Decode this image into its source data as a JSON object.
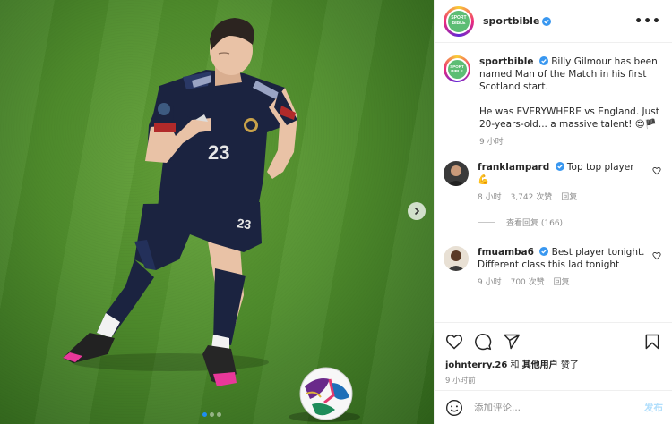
{
  "account": {
    "username": "sportbible",
    "logo_text_top": "SPORT",
    "logo_text_bottom": "BIBLE",
    "brand_color": "#5dbd74",
    "verified_color": "#3897f0"
  },
  "header": {
    "more_label": "•••"
  },
  "caption": {
    "username": "sportbible",
    "text_1": "Billy Gilmour has been named Man of the Match in his first Scotland start.",
    "text_2": "He was EVERYWHERE vs England. Just 20-years-old... a massive talent! 😍🏴",
    "time": "9 小时"
  },
  "comments": [
    {
      "username": "franklampard",
      "text": "Top top player",
      "second_line": "💪",
      "time": "8 小时",
      "likes": "3,742 次赞",
      "reply": "回复",
      "view_replies": "查看回复 (166)"
    },
    {
      "username": "fmuamba6",
      "text": "Best player tonight. Different class this lad tonight",
      "time": "9 小时",
      "likes": "700 次赞",
      "reply": "回复"
    }
  ],
  "likes": {
    "first_user": "johnterry.26",
    "connector": "和",
    "others": "其他用户",
    "suffix": "赞了",
    "time": "9 小时前"
  },
  "add_comment": {
    "placeholder": "添加评论...",
    "post_label": "发布"
  },
  "media": {
    "jersey_number": "23",
    "carousel_total": 3,
    "carousel_active": 1
  }
}
